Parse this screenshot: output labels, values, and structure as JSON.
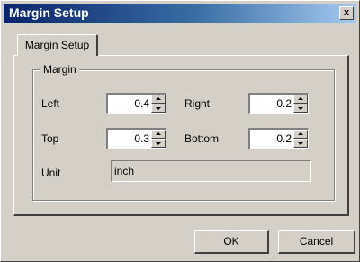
{
  "window": {
    "title": "Margin Setup",
    "close_label": "x"
  },
  "tabs": [
    {
      "label": "Margin Setup",
      "selected": true
    }
  ],
  "group": {
    "title": "Margin"
  },
  "fields": {
    "left": {
      "label": "Left",
      "value": "0.4"
    },
    "right": {
      "label": "Right",
      "value": "0.2"
    },
    "top": {
      "label": "Top",
      "value": "0.3"
    },
    "bottom": {
      "label": "Bottom",
      "value": "0.2"
    }
  },
  "unit": {
    "label": "Unit",
    "value": "inch"
  },
  "buttons": {
    "ok": "OK",
    "cancel": "Cancel"
  },
  "colors": {
    "dialog_face": "#d4d0c8",
    "titlebar_start": "#0a246a",
    "titlebar_end": "#a6caf0",
    "title_text": "#ffffff"
  }
}
